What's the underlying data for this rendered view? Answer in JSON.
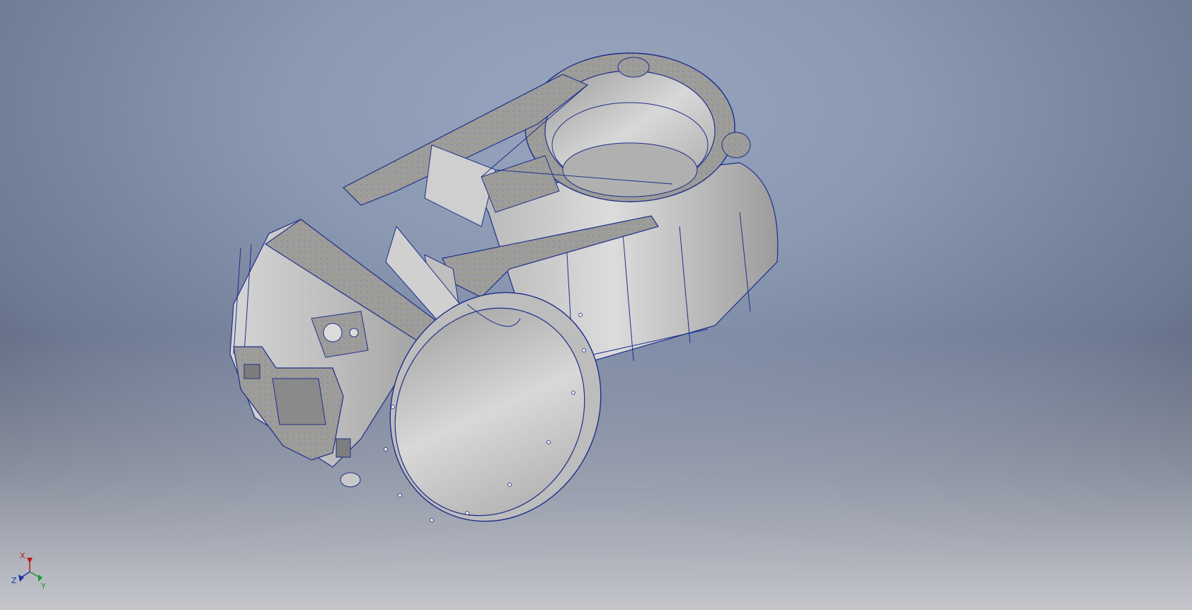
{
  "viewport": {
    "background_top": "#97a5c0",
    "background_edge": "#525c71",
    "floor_color": "#cbccd1",
    "model_fill": "#c4c4c4",
    "edge_color": "#1f2f8a",
    "section_fill": "#9a9a9a"
  },
  "triad": {
    "x_label": "X",
    "y_label": "Y",
    "z_label": "Z",
    "x_color": "#c01818",
    "y_color": "#1a9a2a",
    "z_color": "#1b2fa8"
  }
}
